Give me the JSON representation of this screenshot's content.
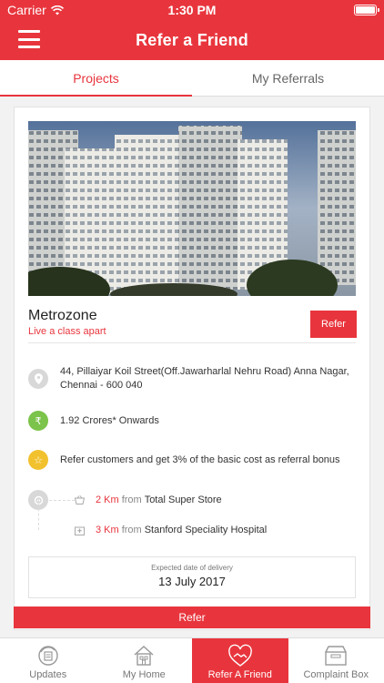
{
  "status": {
    "carrier": "Carrier",
    "time": "1:30 PM"
  },
  "header": {
    "title": "Refer a Friend"
  },
  "tabs": [
    {
      "label": "Projects",
      "active": true
    },
    {
      "label": "My Referrals",
      "active": false
    }
  ],
  "project": {
    "name": "Metrozone",
    "tagline": "Live a class apart",
    "refer_label": "Refer",
    "address": "44, Pillaiyar Koil Street(Off.Jawarharlal Nehru Road)  Anna Nagar, Chennai - 600 040",
    "price": "1.92 Crores* Onwards",
    "bonus": "Refer customers and get 3% of the basic cost as referral bonus",
    "nearby": [
      {
        "distance": "2 Km",
        "from": "from",
        "place": "Total Super Store",
        "icon": "basket-icon"
      },
      {
        "distance": "3 Km",
        "from": "from",
        "place": "Stanford Speciality Hospital",
        "icon": "hospital-icon"
      }
    ],
    "delivery_label": "Expected date of delivery",
    "delivery_date": "13 July 2017",
    "bottom_refer_label": "Refer"
  },
  "bottom_nav": [
    {
      "label": "Updates",
      "icon": "updates-icon",
      "active": false
    },
    {
      "label": "My Home",
      "icon": "home-icon",
      "active": false
    },
    {
      "label": "Refer A Friend",
      "icon": "handshake-icon",
      "active": true
    },
    {
      "label": "Complaint Box",
      "icon": "box-icon",
      "active": false
    }
  ],
  "colors": {
    "accent": "#e8353d",
    "green": "#7bc34a",
    "yellow": "#f2c12e"
  }
}
